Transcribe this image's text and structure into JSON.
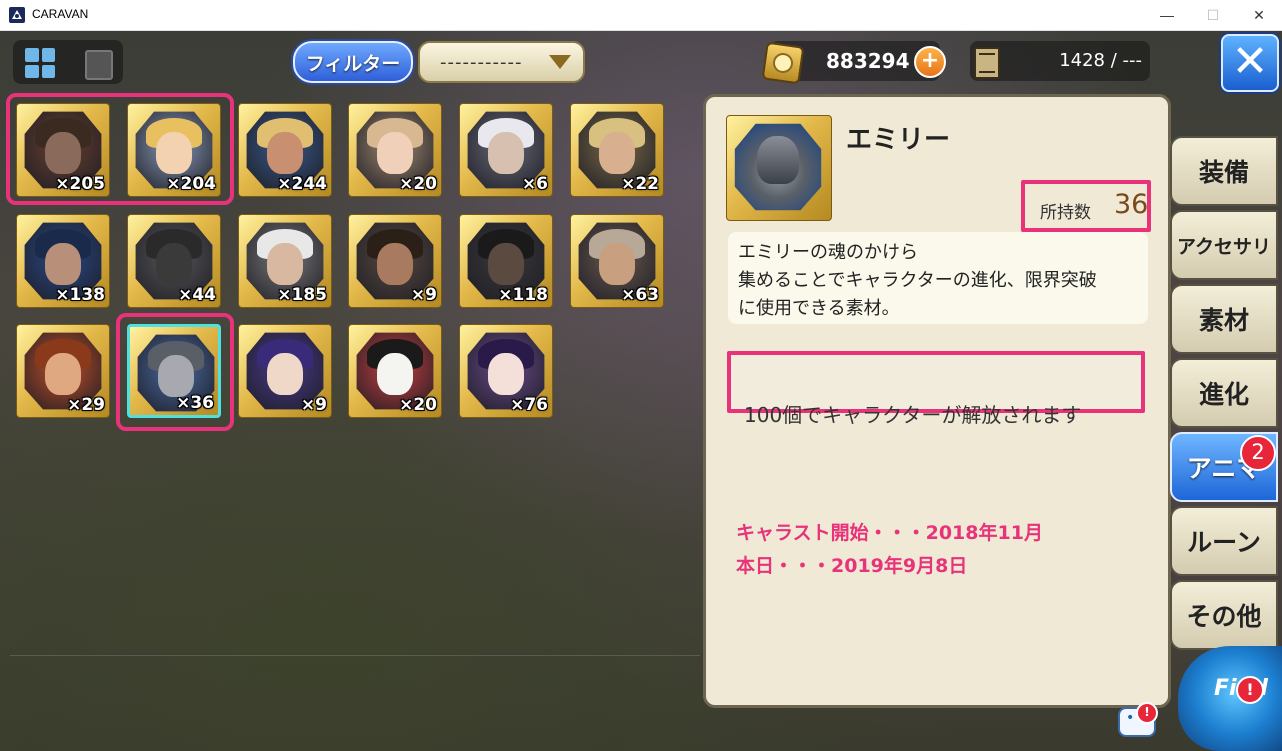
{
  "window": {
    "title": "CARAVAN",
    "minimize": "—",
    "maximize": "☐",
    "close": "✕"
  },
  "toolbar": {
    "filter_label": "フィルター",
    "dropdown_value": "-----------",
    "gold": "883294",
    "plus": "+",
    "storage": "1428 / ---",
    "close_label": "✕"
  },
  "cards": [
    {
      "count": "×205",
      "skin": "#8a6a5a",
      "hair": "#3a2a20",
      "bg": "#6a4030",
      "highlighted": true
    },
    {
      "count": "×204",
      "skin": "#f2d2b0",
      "hair": "#e8c060",
      "bg": "#8a9ab8",
      "highlighted": true
    },
    {
      "count": "×244",
      "skin": "#c89070",
      "hair": "#e0c070",
      "bg": "#3a5a8a"
    },
    {
      "count": "×20",
      "skin": "#f0d0b8",
      "hair": "#d8b890",
      "bg": "#a08870"
    },
    {
      "count": "×6",
      "skin": "#d8c0b0",
      "hair": "#e8e8ee",
      "bg": "#6a6a78"
    },
    {
      "count": "×22",
      "skin": "#d8b090",
      "hair": "#d8c080",
      "bg": "#7a6a48"
    },
    {
      "count": "×138",
      "skin": "#b8907a",
      "hair": "#1a2a4a",
      "bg": "#2a4a8a"
    },
    {
      "count": "×44",
      "skin": "#3a3a3a",
      "hair": "#2a2a2a",
      "bg": "#585858"
    },
    {
      "count": "×185",
      "skin": "#d8b8a0",
      "hair": "#e8e8e8",
      "bg": "#7a7a7a"
    },
    {
      "count": "×9",
      "skin": "#a87a60",
      "hair": "#2a2018",
      "bg": "#5a4a40"
    },
    {
      "count": "×118",
      "skin": "#5a4a40",
      "hair": "#1a1a1a",
      "bg": "#3a3a3a"
    },
    {
      "count": "×63",
      "skin": "#c8a080",
      "hair": "#b8a898",
      "bg": "#6a5a50"
    },
    {
      "count": "×29",
      "skin": "#e0a880",
      "hair": "#8a3a1a",
      "bg": "#c0502a"
    },
    {
      "count": "×36",
      "skin": "#a8a8b0",
      "hair": "#5a5e66",
      "bg": "#4a6aa0",
      "selected": true,
      "highlighted": true
    },
    {
      "count": "×9",
      "skin": "#f0d8c8",
      "hair": "#3a2a7a",
      "bg": "#4a3a8a"
    },
    {
      "count": "×20",
      "skin": "#f4f4f0",
      "hair": "#1a1a1a",
      "bg": "#c84040"
    },
    {
      "count": "×76",
      "skin": "#f4e0d8",
      "hair": "#2a1a4a",
      "bg": "#6a4a8a"
    }
  ],
  "detail": {
    "name": "エミリー",
    "owned_label": "所持数",
    "owned_value": "36",
    "description": [
      "エミリーの魂のかけら",
      "集めることでキャラクターの進化、限界突破",
      "に使用できる素材。"
    ],
    "unlock_text": "100個でキャラクターが解放されます",
    "annotation": [
      "キャラスト開始・・・2018年11月",
      "本日・・・2019年9月8日"
    ]
  },
  "tabs": [
    {
      "label": "装備"
    },
    {
      "label": "アクセサリ",
      "small": true
    },
    {
      "label": "素材"
    },
    {
      "label": "進化"
    },
    {
      "label": "アニマ",
      "active": true,
      "badge": "2"
    },
    {
      "label": "ルーン"
    },
    {
      "label": "その他"
    }
  ],
  "find_label": "Find",
  "alert_mark": "!",
  "colors": {
    "highlight": "#e8337a",
    "accent_blue": "#1d66d8",
    "card_gold": "#e3b84a"
  }
}
